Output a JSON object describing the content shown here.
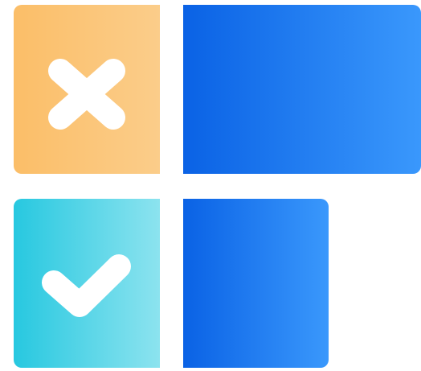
{
  "rows": [
    {
      "status_icon": "cross-icon",
      "status_color_start": "#fbbe68",
      "status_color_end": "#fbcd8a",
      "bar_color_start": "#0a62e5",
      "bar_color_end": "#3a98fc",
      "bar_level": 1.0
    },
    {
      "status_icon": "check-icon",
      "status_color_start": "#27c8e0",
      "status_color_end": "#8ce3ef",
      "bar_color_start": "#0a62e5",
      "bar_color_end": "#3a98fc",
      "bar_level": 0.61
    }
  ]
}
